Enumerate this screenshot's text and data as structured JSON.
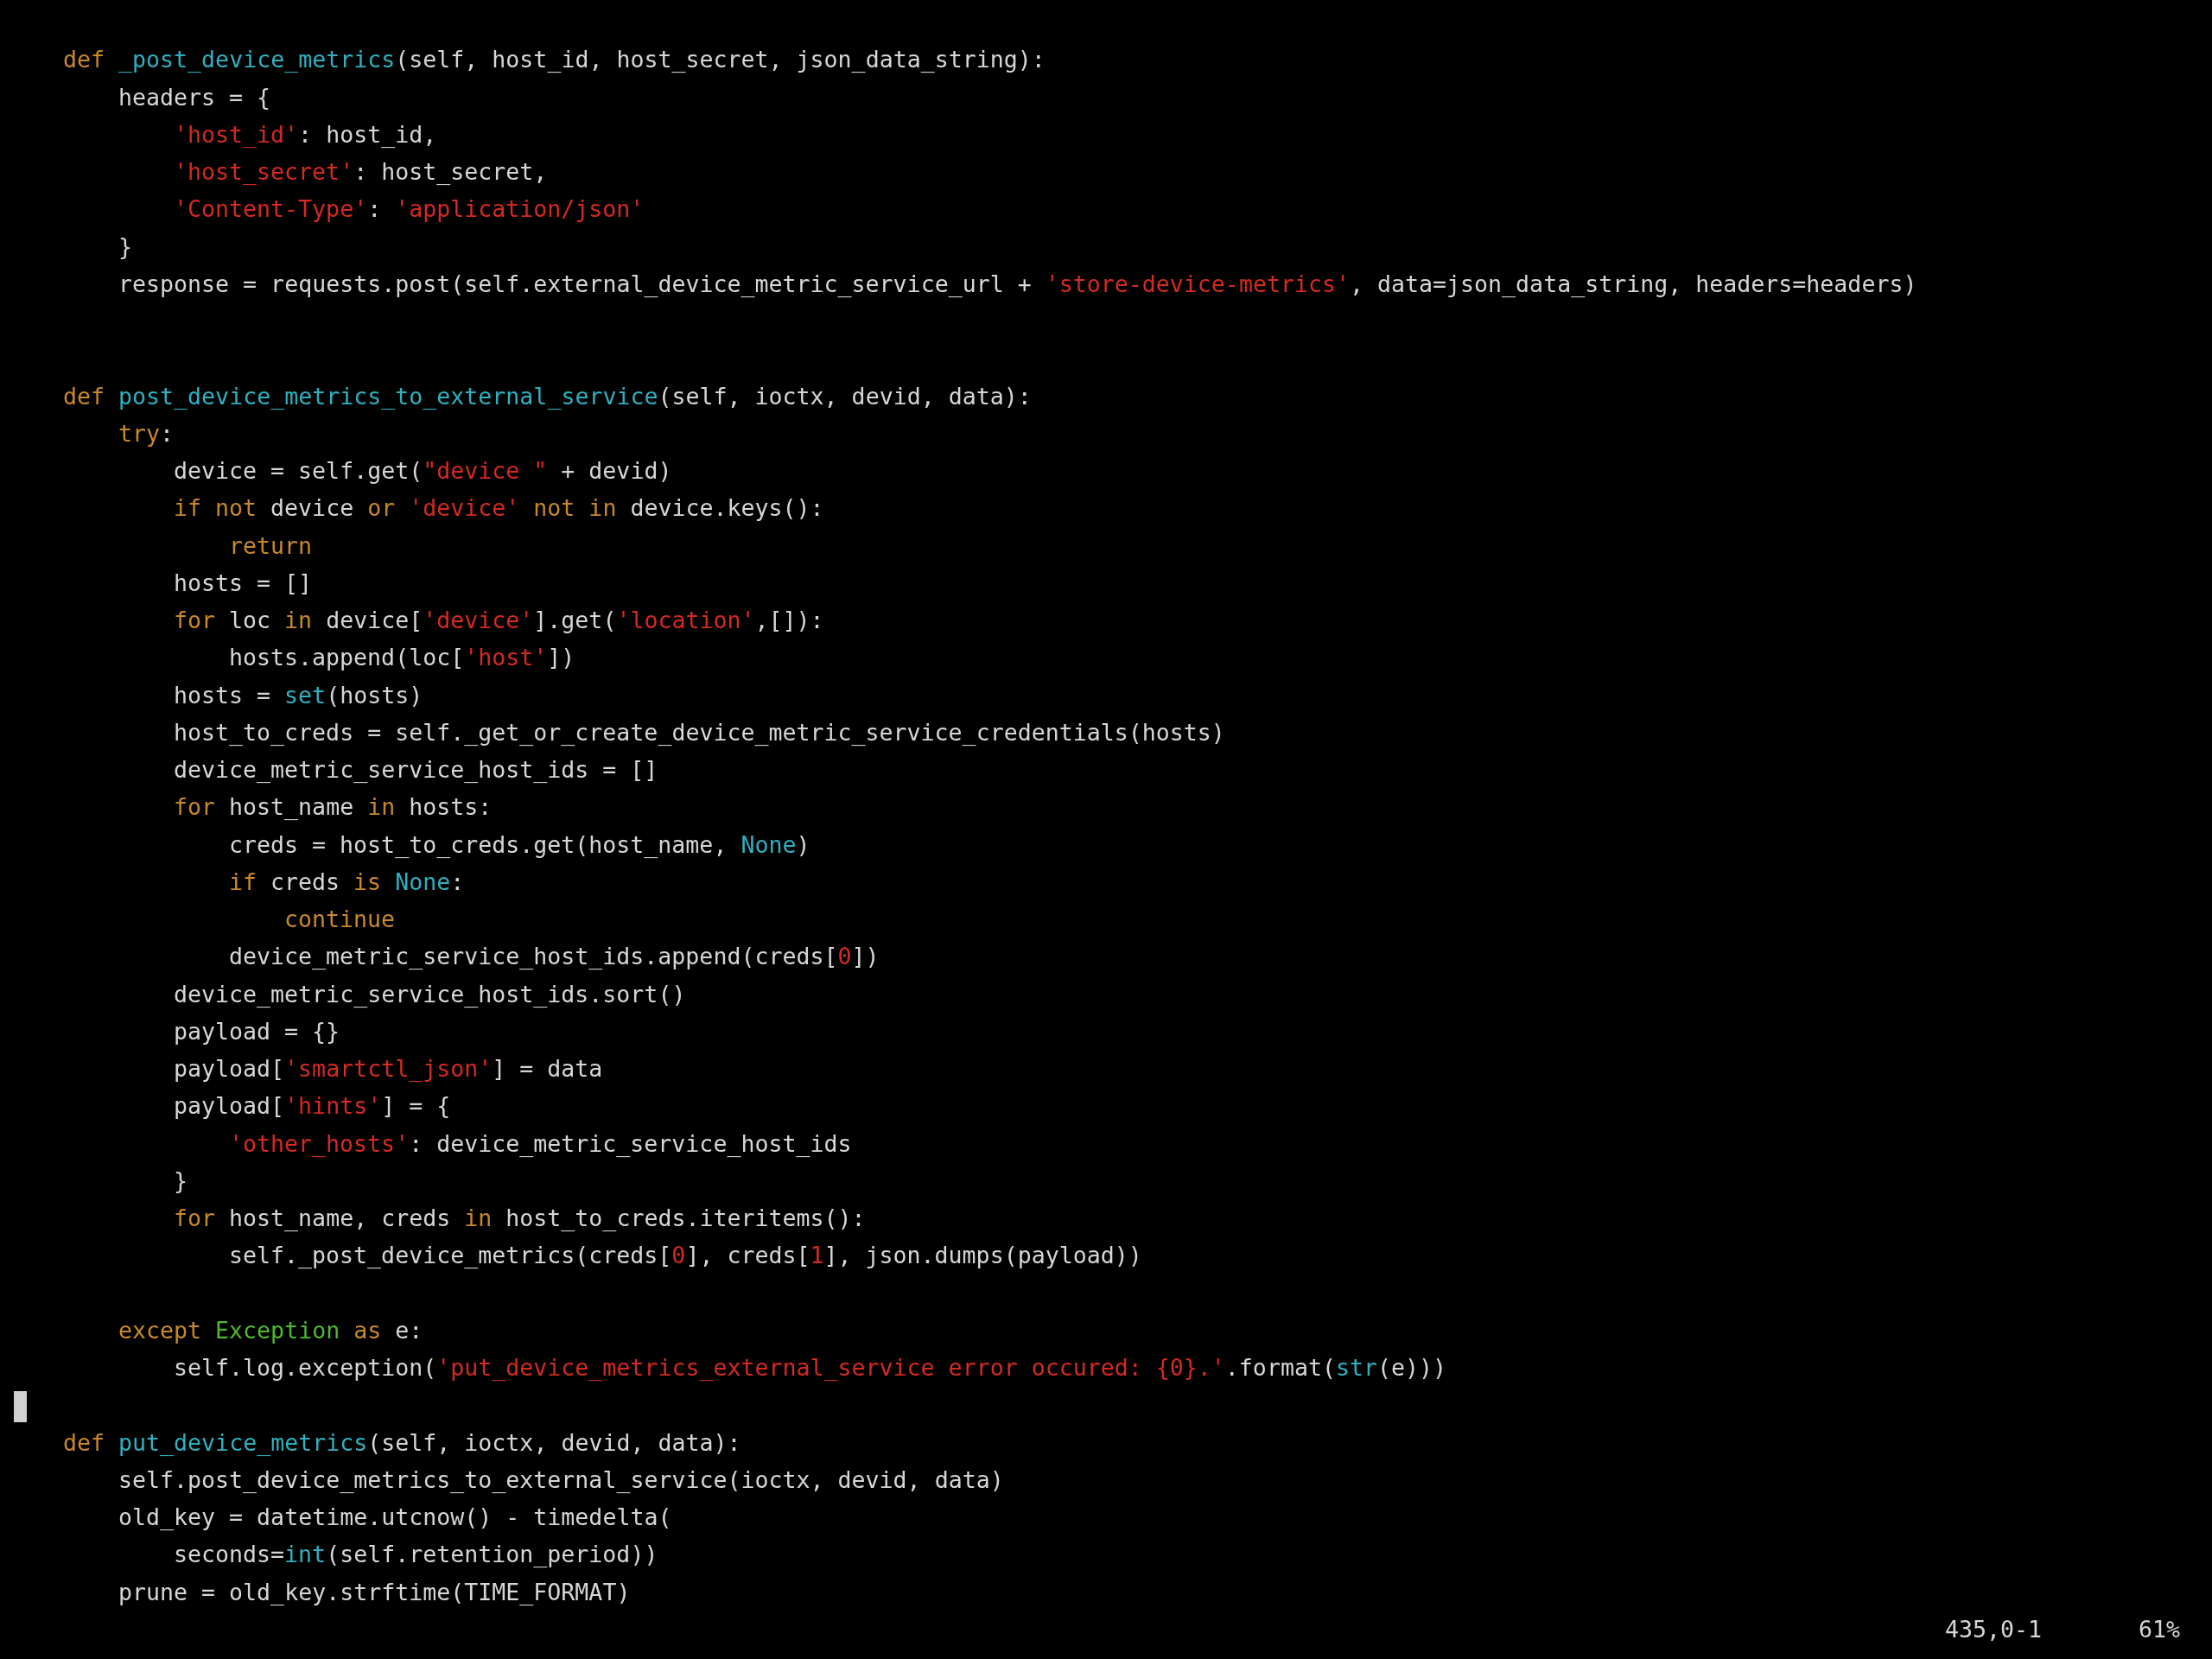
{
  "editor": {
    "lines": [
      {
        "kind": "blank"
      },
      {
        "kind": "code",
        "tokens": [
          {
            "kind": "keyword",
            "text": "def "
          },
          {
            "kind": "function",
            "text": "_post_device_metrics"
          },
          {
            "kind": "plain",
            "text": "(self, host_id, host_secret, json_data_string):"
          }
        ],
        "children": [
          {
            "kind": "code",
            "tokens": [
              {
                "kind": "plain",
                "text": "headers = {"
              }
            ],
            "children": [
              {
                "kind": "code",
                "tokens": [
                  {
                    "kind": "string",
                    "text": "'host_id'"
                  },
                  {
                    "kind": "plain",
                    "text": ": host_id,"
                  }
                ]
              },
              {
                "kind": "code",
                "tokens": [
                  {
                    "kind": "string",
                    "text": "'host_secret'"
                  },
                  {
                    "kind": "plain",
                    "text": ": host_secret,"
                  }
                ]
              },
              {
                "kind": "code",
                "tokens": [
                  {
                    "kind": "string",
                    "text": "'Content-Type'"
                  },
                  {
                    "kind": "plain",
                    "text": ": "
                  },
                  {
                    "kind": "string",
                    "text": "'application/json'"
                  }
                ]
              }
            ]
          },
          {
            "kind": "code",
            "tokens": [
              {
                "kind": "plain",
                "text": "}"
              }
            ]
          },
          {
            "kind": "code",
            "tokens": [
              {
                "kind": "plain",
                "text": "response = requests.post(self.external_device_metric_service_url + "
              },
              {
                "kind": "string",
                "text": "'store-device-metrics'"
              },
              {
                "kind": "plain",
                "text": ", data=json_data_string, headers=headers)"
              }
            ]
          }
        ]
      },
      {
        "kind": "blank"
      },
      {
        "kind": "blank"
      },
      {
        "kind": "code",
        "tokens": [
          {
            "kind": "keyword",
            "text": "def "
          },
          {
            "kind": "function",
            "text": "post_device_metrics_to_external_service"
          },
          {
            "kind": "plain",
            "text": "(self, ioctx, devid, data):"
          }
        ],
        "children": [
          {
            "kind": "code",
            "tokens": [
              {
                "kind": "keyword",
                "text": "try"
              },
              {
                "kind": "plain",
                "text": ":"
              }
            ],
            "children": [
              {
                "kind": "code",
                "tokens": [
                  {
                    "kind": "plain",
                    "text": "device = self.get("
                  },
                  {
                    "kind": "string",
                    "text": "\"device \""
                  },
                  {
                    "kind": "plain",
                    "text": " + devid)"
                  }
                ]
              },
              {
                "kind": "code",
                "tokens": [
                  {
                    "kind": "keyword",
                    "text": "if not"
                  },
                  {
                    "kind": "plain",
                    "text": " device "
                  },
                  {
                    "kind": "keyword",
                    "text": "or "
                  },
                  {
                    "kind": "string",
                    "text": "'device'"
                  },
                  {
                    "kind": "keyword",
                    "text": " not in"
                  },
                  {
                    "kind": "plain",
                    "text": " device.keys():"
                  }
                ],
                "children": [
                  {
                    "kind": "code",
                    "tokens": [
                      {
                        "kind": "keyword",
                        "text": "return"
                      }
                    ]
                  }
                ]
              },
              {
                "kind": "code",
                "tokens": [
                  {
                    "kind": "plain",
                    "text": "hosts = []"
                  }
                ]
              },
              {
                "kind": "code",
                "tokens": [
                  {
                    "kind": "keyword",
                    "text": "for"
                  },
                  {
                    "kind": "plain",
                    "text": " loc "
                  },
                  {
                    "kind": "keyword",
                    "text": "in"
                  },
                  {
                    "kind": "plain",
                    "text": " device["
                  },
                  {
                    "kind": "string",
                    "text": "'device'"
                  },
                  {
                    "kind": "plain",
                    "text": "].get("
                  },
                  {
                    "kind": "string",
                    "text": "'location'"
                  },
                  {
                    "kind": "plain",
                    "text": ",[]):"
                  }
                ],
                "children": [
                  {
                    "kind": "code",
                    "tokens": [
                      {
                        "kind": "plain",
                        "text": "hosts.append(loc["
                      },
                      {
                        "kind": "string",
                        "text": "'host'"
                      },
                      {
                        "kind": "plain",
                        "text": "])"
                      }
                    ]
                  }
                ]
              },
              {
                "kind": "code",
                "tokens": [
                  {
                    "kind": "plain",
                    "text": "hosts = "
                  },
                  {
                    "kind": "builtin",
                    "text": "set"
                  },
                  {
                    "kind": "plain",
                    "text": "(hosts)"
                  }
                ]
              },
              {
                "kind": "code",
                "tokens": [
                  {
                    "kind": "plain",
                    "text": "host_to_creds = self._get_or_create_device_metric_service_credentials(hosts)"
                  }
                ]
              },
              {
                "kind": "code",
                "tokens": [
                  {
                    "kind": "plain",
                    "text": "device_metric_service_host_ids = []"
                  }
                ]
              },
              {
                "kind": "code",
                "tokens": [
                  {
                    "kind": "keyword",
                    "text": "for"
                  },
                  {
                    "kind": "plain",
                    "text": " host_name "
                  },
                  {
                    "kind": "keyword",
                    "text": "in"
                  },
                  {
                    "kind": "plain",
                    "text": " hosts:"
                  }
                ],
                "children": [
                  {
                    "kind": "code",
                    "tokens": [
                      {
                        "kind": "plain",
                        "text": "creds = host_to_creds.get(host_name, "
                      },
                      {
                        "kind": "builtin",
                        "text": "None"
                      },
                      {
                        "kind": "plain",
                        "text": ")"
                      }
                    ]
                  },
                  {
                    "kind": "code",
                    "tokens": [
                      {
                        "kind": "keyword",
                        "text": "if"
                      },
                      {
                        "kind": "plain",
                        "text": " creds "
                      },
                      {
                        "kind": "keyword",
                        "text": "is "
                      },
                      {
                        "kind": "builtin",
                        "text": "None"
                      },
                      {
                        "kind": "plain",
                        "text": ":"
                      }
                    ],
                    "children": [
                      {
                        "kind": "code",
                        "tokens": [
                          {
                            "kind": "keyword",
                            "text": "continue"
                          }
                        ]
                      }
                    ]
                  },
                  {
                    "kind": "code",
                    "tokens": [
                      {
                        "kind": "plain",
                        "text": "device_metric_service_host_ids.append(creds["
                      },
                      {
                        "kind": "number",
                        "text": "0"
                      },
                      {
                        "kind": "plain",
                        "text": "])"
                      }
                    ]
                  }
                ]
              },
              {
                "kind": "code",
                "tokens": [
                  {
                    "kind": "plain",
                    "text": "device_metric_service_host_ids.sort()"
                  }
                ]
              },
              {
                "kind": "code",
                "tokens": [
                  {
                    "kind": "plain",
                    "text": "payload = {}"
                  }
                ]
              },
              {
                "kind": "code",
                "tokens": [
                  {
                    "kind": "plain",
                    "text": "payload["
                  },
                  {
                    "kind": "string",
                    "text": "'smartctl_json'"
                  },
                  {
                    "kind": "plain",
                    "text": "] = data"
                  }
                ]
              },
              {
                "kind": "code",
                "tokens": [
                  {
                    "kind": "plain",
                    "text": "payload["
                  },
                  {
                    "kind": "string",
                    "text": "'hints'"
                  },
                  {
                    "kind": "plain",
                    "text": "] = {"
                  }
                ],
                "children": [
                  {
                    "kind": "code",
                    "tokens": [
                      {
                        "kind": "string",
                        "text": "'other_hosts'"
                      },
                      {
                        "kind": "plain",
                        "text": ": device_metric_service_host_ids"
                      }
                    ]
                  }
                ]
              },
              {
                "kind": "code",
                "tokens": [
                  {
                    "kind": "plain",
                    "text": "}"
                  }
                ]
              },
              {
                "kind": "code",
                "tokens": [
                  {
                    "kind": "keyword",
                    "text": "for"
                  },
                  {
                    "kind": "plain",
                    "text": " host_name, creds "
                  },
                  {
                    "kind": "keyword",
                    "text": "in"
                  },
                  {
                    "kind": "plain",
                    "text": " host_to_creds.iteritems():"
                  }
                ],
                "children": [
                  {
                    "kind": "code",
                    "tokens": [
                      {
                        "kind": "plain",
                        "text": "self._post_device_metrics(creds["
                      },
                      {
                        "kind": "number",
                        "text": "0"
                      },
                      {
                        "kind": "plain",
                        "text": "], creds["
                      },
                      {
                        "kind": "number",
                        "text": "1"
                      },
                      {
                        "kind": "plain",
                        "text": "], json.dumps(payload))"
                      }
                    ]
                  }
                ]
              }
            ]
          },
          {
            "kind": "blank"
          },
          {
            "kind": "code",
            "tokens": [
              {
                "kind": "keyword",
                "text": "except "
              },
              {
                "kind": "class",
                "text": "Exception"
              },
              {
                "kind": "keyword",
                "text": " as"
              },
              {
                "kind": "plain",
                "text": " e:"
              }
            ],
            "children": [
              {
                "kind": "code",
                "tokens": [
                  {
                    "kind": "plain",
                    "text": "self.log.exception("
                  },
                  {
                    "kind": "string",
                    "text": "'put_device_metrics_external_service error occured: {0}.'"
                  },
                  {
                    "kind": "plain",
                    "text": ".format("
                  },
                  {
                    "kind": "builtin",
                    "text": "str"
                  },
                  {
                    "kind": "plain",
                    "text": "(e)))"
                  }
                ]
              }
            ]
          }
        ]
      },
      {
        "kind": "cursor"
      },
      {
        "kind": "code",
        "tokens": [
          {
            "kind": "keyword",
            "text": "def "
          },
          {
            "kind": "function",
            "text": "put_device_metrics"
          },
          {
            "kind": "plain",
            "text": "(self, ioctx, devid, data):"
          }
        ],
        "children": [
          {
            "kind": "code",
            "tokens": [
              {
                "kind": "plain",
                "text": "self.post_device_metrics_to_external_service(ioctx, devid, data)"
              }
            ]
          },
          {
            "kind": "code",
            "tokens": [
              {
                "kind": "plain",
                "text": "old_key = datetime.utcnow() - timedelta("
              }
            ],
            "children": [
              {
                "kind": "code",
                "tokens": [
                  {
                    "kind": "plain",
                    "text": "seconds="
                  },
                  {
                    "kind": "builtin",
                    "text": "int"
                  },
                  {
                    "kind": "plain",
                    "text": "(self.retention_period))"
                  }
                ]
              }
            ]
          },
          {
            "kind": "code",
            "tokens": [
              {
                "kind": "plain",
                "text": "prune = old_key.strftime(TIME_FORMAT)"
              }
            ]
          }
        ]
      }
    ]
  },
  "status_bar": {
    "position": "435,0-1",
    "scroll": "61%"
  }
}
